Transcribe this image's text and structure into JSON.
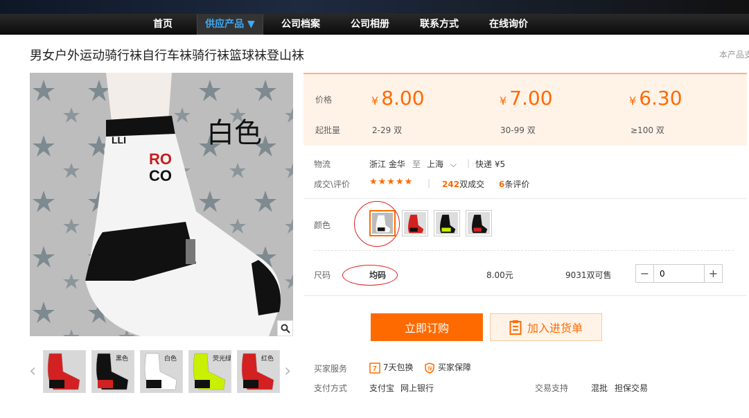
{
  "nav": {
    "items": [
      "首页",
      "供应产品 ▼",
      "公司档案",
      "公司相册",
      "联系方式",
      "在线询价"
    ],
    "active_index": 1
  },
  "product": {
    "title": "男女户外运动骑行袜自行车袜骑行袜篮球袜登山袜",
    "right_note": "本产品支",
    "main_image_caption": "白色"
  },
  "pricing": {
    "price_label": "价格",
    "moq_label": "起批量",
    "currency": "¥",
    "tiers": [
      {
        "price": "8.00",
        "range": "2-29",
        "unit": "双"
      },
      {
        "price": "7.00",
        "range": "30-99",
        "unit": "双"
      },
      {
        "price": "6.30",
        "range": "≥100",
        "unit": "双"
      }
    ]
  },
  "logistics": {
    "label": "物流",
    "from": "浙江 金华",
    "to_word": "至",
    "to": "上海",
    "shipping": "快递 ¥5"
  },
  "reviews": {
    "label": "成交\\评价",
    "stars": "★★★★★",
    "deals_count": "242",
    "deals_suffix": "双成交",
    "review_count": "6",
    "review_suffix": "条评价"
  },
  "color": {
    "label": "颜色",
    "swatches": [
      "white",
      "red",
      "fluorescent-green",
      "black"
    ]
  },
  "size": {
    "label": "尺码",
    "value": "均码",
    "price": "8.00元",
    "stock": "9031双可售",
    "quantity": "0"
  },
  "actions": {
    "order": "立即订购",
    "cart": "加入进货单"
  },
  "services": {
    "buyer_label": "买家服务",
    "return": "7天包换",
    "protection": "买家保障",
    "payment_label": "支付方式",
    "alipay": "支付宝",
    "bank": "网上银行",
    "trade_label": "交易支持",
    "mixed": "混批",
    "guarantee": "担保交易"
  },
  "gallery": {
    "thumbs": [
      {
        "tag": "",
        "color": "#d32020"
      },
      {
        "tag": "黑色",
        "color": "#111111"
      },
      {
        "tag": "白色",
        "color": "#ffffff"
      },
      {
        "tag": "荧光绿",
        "color": "#c8f000"
      },
      {
        "tag": "红色",
        "color": "#d32020"
      }
    ]
  }
}
